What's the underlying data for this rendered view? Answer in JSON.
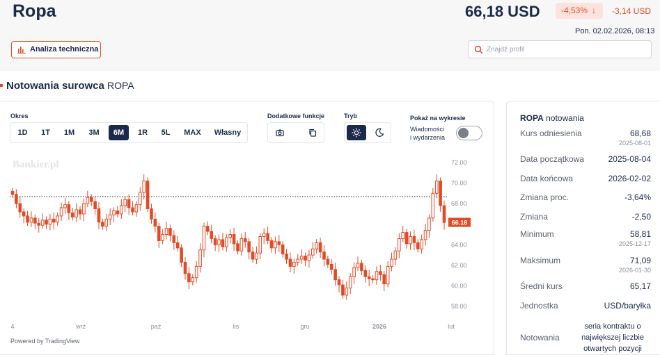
{
  "header": {
    "title": "Ropa",
    "price": "66,18 USD",
    "change_pct": "-4,53%",
    "change_arrow": "↓",
    "change_abs": "-3,14 USD",
    "date": "Pon. 02.02.2026, 08:13",
    "analiza_label": "Analiza techniczna",
    "search_placeholder": "Znajdź profil"
  },
  "section": {
    "title": "Notowania surowca",
    "subtitle": "ROPA"
  },
  "controls": {
    "okres_label": "Okres",
    "periods": [
      "1D",
      "1T",
      "1M",
      "3M",
      "6M",
      "1R",
      "5L",
      "MAX",
      "Własny"
    ],
    "active_period": "6M",
    "extra_label": "Dodatkowe funkcje",
    "mode_label": "Tryb",
    "show_label": "Pokaż na wykresie",
    "toggle_label_1": "Wiadomości",
    "toggle_label_2": "i wydarzenia",
    "toggle_on": false
  },
  "chart_data": {
    "type": "candlestick",
    "watermark": "Bankier.pl",
    "x_ticks": [
      "4",
      "wrz",
      "paź",
      "lis",
      "gru",
      "2026",
      "lut"
    ],
    "y_ticks": [
      "72.00",
      "70.00",
      "68.00",
      "66.00",
      "64.00",
      "62.00",
      "60.00",
      "58.00"
    ],
    "ylim": [
      57,
      72.6
    ],
    "reference_line": 68.68,
    "last_price_label": "66.18",
    "last_price": 66.18,
    "closes": [
      68.9,
      68.0,
      67.2,
      66.8,
      66.2,
      66.6,
      66.1,
      65.9,
      66.4,
      66.0,
      66.5,
      66.2,
      66.8,
      67.6,
      67.9,
      67.1,
      66.7,
      67.4,
      67.0,
      68.0,
      68.6,
      68.2,
      67.5,
      66.2,
      65.8,
      66.5,
      66.9,
      67.3,
      67.0,
      67.8,
      68.4,
      67.6,
      67.2,
      67.9,
      69.1,
      70.2,
      67.5,
      66.5,
      65.8,
      64.4,
      65.0,
      65.6,
      64.9,
      64.2,
      63.7,
      62.3,
      61.2,
      60.4,
      60.8,
      61.9,
      63.5,
      65.8,
      65.3,
      64.6,
      64.0,
      64.5,
      63.8,
      64.7,
      65.0,
      64.1,
      63.4,
      64.6,
      64.3,
      63.3,
      62.6,
      63.2,
      64.8,
      65.1,
      64.4,
      63.7,
      64.3,
      64.0,
      63.1,
      62.6,
      61.9,
      62.3,
      62.6,
      62.9,
      62.5,
      63.0,
      63.6,
      64.2,
      63.3,
      62.6,
      62.1,
      61.6,
      60.6,
      60.1,
      59.1,
      59.8,
      60.9,
      61.8,
      62.2,
      61.5,
      60.9,
      60.7,
      60.6,
      61.4,
      61.1,
      60.2,
      61.9,
      62.6,
      63.4,
      64.6,
      65.2,
      64.1,
      64.8,
      64.2,
      63.6,
      64.5,
      65.4,
      66.6,
      69.0,
      70.2,
      67.8,
      66.18
    ],
    "color_up": "#e24b26",
    "color_down": "#e24b26"
  },
  "powered_by": "Powered by TradingView",
  "stats": {
    "title_bold": "ROPA",
    "title_rest": "notowania",
    "rows": [
      {
        "label": "Kurs odniesienia",
        "value": "68,68",
        "sub": "2025-08-01"
      },
      {
        "label": "Data początkowa",
        "value": "2025-08-04",
        "sub": ""
      },
      {
        "label": "Data końcowa",
        "value": "2026-02-02",
        "sub": ""
      },
      {
        "label": "Zmiana proc.",
        "value": "-3,64%",
        "sub": ""
      },
      {
        "label": "Zmiana",
        "value": "-2,50",
        "sub": ""
      },
      {
        "label": "Minimum",
        "value": "58,81",
        "sub": "2025-12-17"
      },
      {
        "label": "Maksimum",
        "value": "71,09",
        "sub": "2026-01-30"
      },
      {
        "label": "Średni kurs",
        "value": "65,17",
        "sub": ""
      },
      {
        "label": "Jednostka",
        "value": "USD/baryłka",
        "sub": ""
      }
    ],
    "notowania_label": "Notowania",
    "notowania_value": "seria kontraktu o największej liczbie otwartych pozycji"
  },
  "colors": {
    "accent": "#e24b26",
    "navy": "#1b2a4a",
    "header_bg": "#f7f7f7"
  },
  "icons": {
    "analiza": "bar-chart-icon",
    "search": "search-icon",
    "screenshot": "camera-icon",
    "copy": "copy-icon",
    "light": "sun-icon",
    "dark": "moon-icon"
  }
}
